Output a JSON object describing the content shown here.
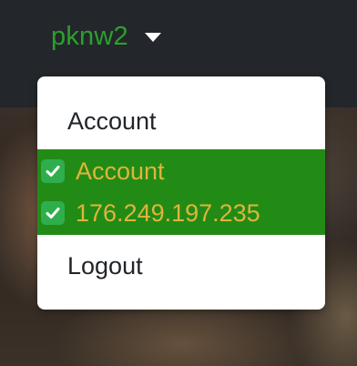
{
  "nav": {
    "username": "pknw2"
  },
  "menu": {
    "items": [
      {
        "label": "Account",
        "checked": false
      },
      {
        "label": "Account",
        "checked": true,
        "icon": "check-mark-icon"
      },
      {
        "label": "176.249.197.235",
        "checked": true,
        "icon": "check-mark-icon"
      },
      {
        "label": "Logout",
        "checked": false
      }
    ]
  },
  "colors": {
    "navbar_bg": "#23272b",
    "username": "#2ca02c",
    "active_bg": "#228b16",
    "active_text": "#e0b43a",
    "menu_text": "#212529",
    "check_badge": "#2fae4e"
  }
}
